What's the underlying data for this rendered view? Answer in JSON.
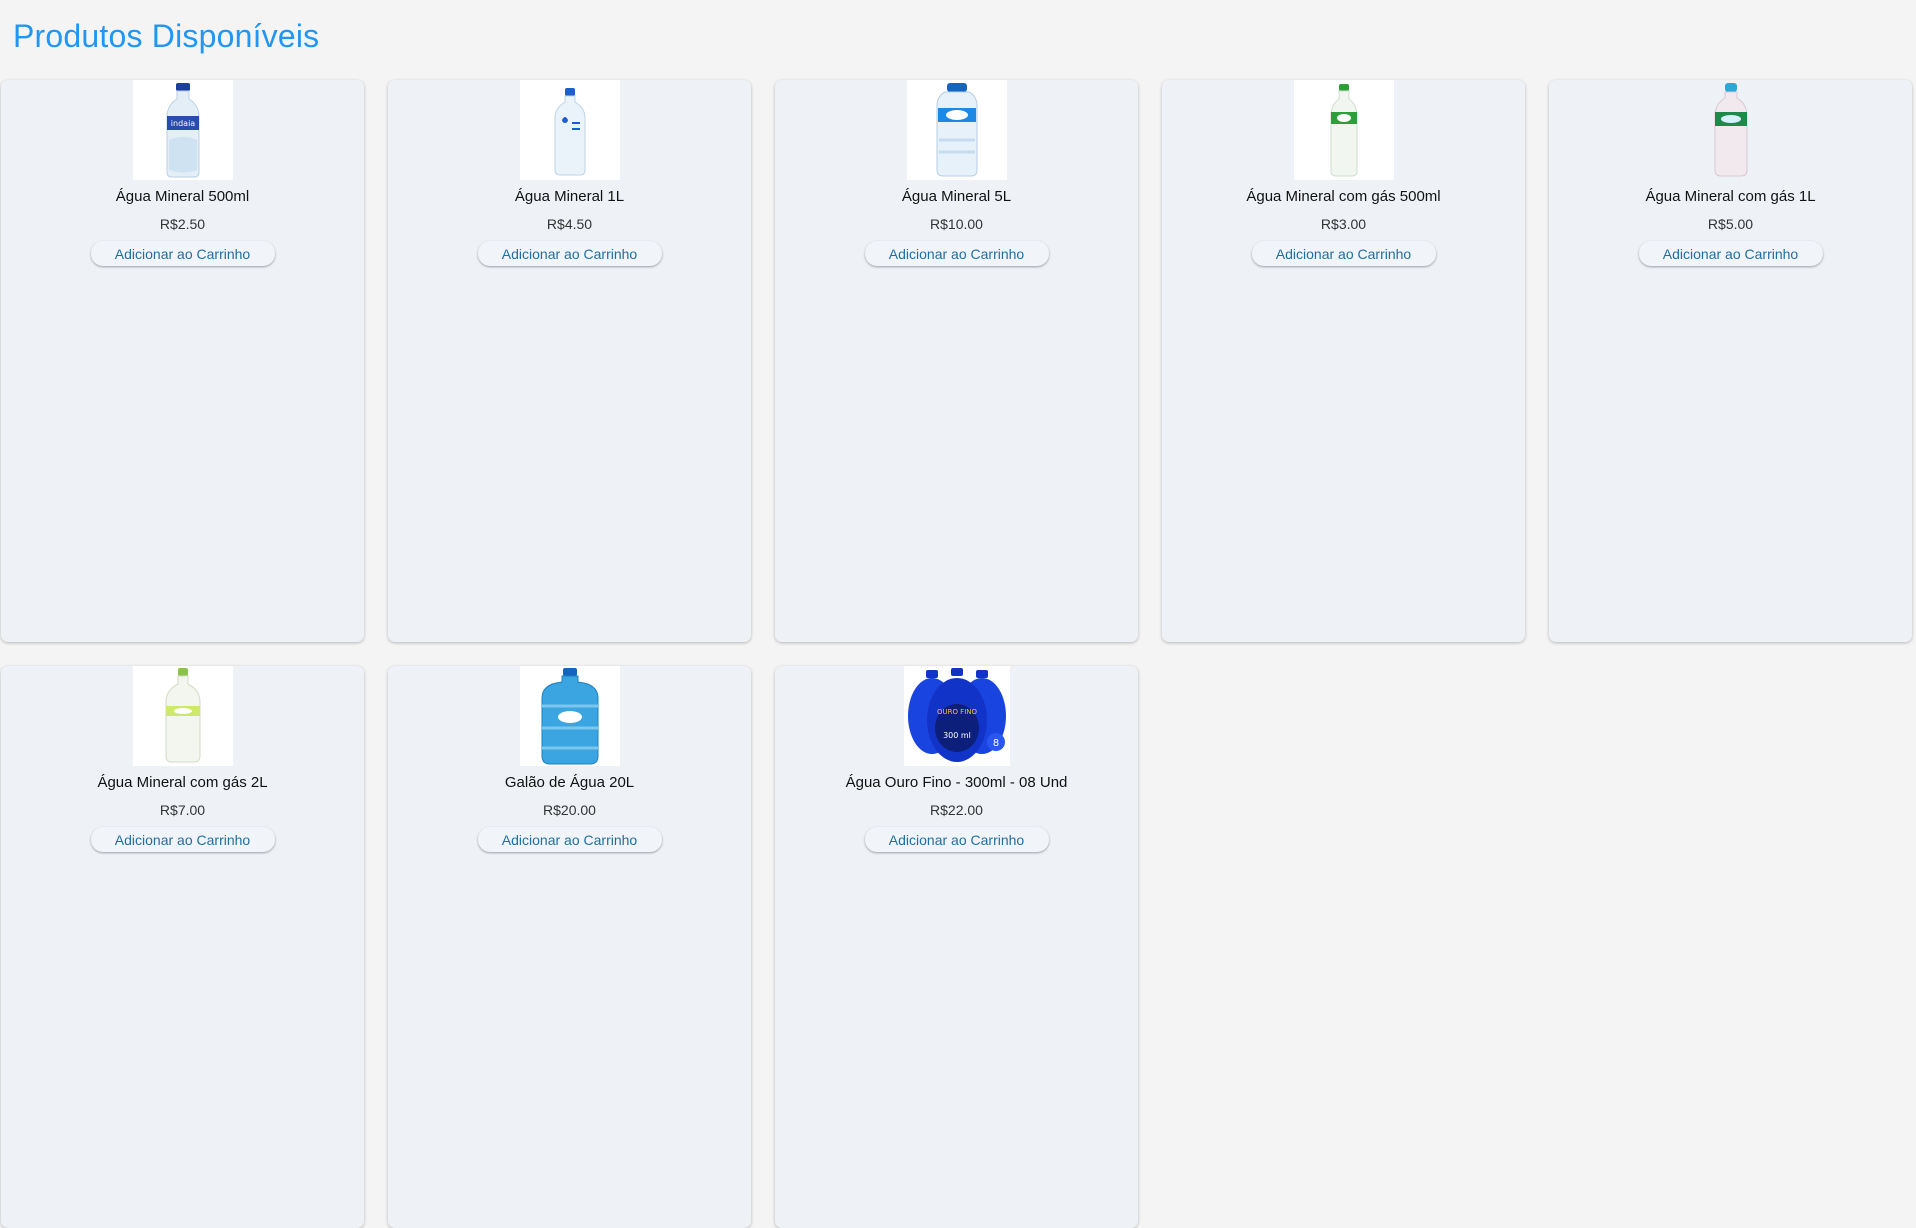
{
  "page": {
    "title": "Produtos Disponíveis"
  },
  "colors": {
    "title": "#2196f3",
    "card_bg": "#eef2f7",
    "button_text": "#1f6fa3"
  },
  "products": [
    {
      "name": "Água Mineral 500ml",
      "price": "R$2.50",
      "button": "Adicionar ao Carrinho",
      "image": "bottle-500ml-icon",
      "cap": "#1a3fa0",
      "label": "#2a4bb0"
    },
    {
      "name": "Água Mineral 1L",
      "price": "R$4.50",
      "button": "Adicionar ao Carrinho",
      "image": "bottle-1l-icon",
      "cap": "#1e5fd0",
      "label": "#d8ecf8"
    },
    {
      "name": "Água Mineral 5L",
      "price": "R$10.00",
      "button": "Adicionar ao Carrinho",
      "image": "bottle-5l-icon",
      "cap": "#1565c0",
      "label": "#1e88e5"
    },
    {
      "name": "Água Mineral com gás 500ml",
      "price": "R$3.00",
      "button": "Adicionar ao Carrinho",
      "image": "bottle-sparkling-500ml-icon",
      "cap": "#2e9e3a",
      "label": "#2e9e3a"
    },
    {
      "name": "Água Mineral com gás 1L",
      "price": "R$5.00",
      "button": "Adicionar ao Carrinho",
      "image": "bottle-sparkling-1l-icon",
      "cap": "#2aa7d6",
      "label": "#1d8a4a"
    },
    {
      "name": "Água Mineral com gás 2L",
      "price": "R$7.00",
      "button": "Adicionar ao Carrinho",
      "image": "bottle-sparkling-2l-icon",
      "cap": "#8bc34a",
      "label": "#cde86a"
    },
    {
      "name": "Galão de Água 20L",
      "price": "R$20.00",
      "button": "Adicionar ao Carrinho",
      "image": "water-jug-20l-icon",
      "cap": "#1565c0",
      "label": "#3aa5e0"
    },
    {
      "name": "Água Ouro Fino - 300ml - 08 Und",
      "price": "R$22.00",
      "button": "Adicionar ao Carrinho",
      "image": "ouro-fino-pack-icon",
      "cap": "#1233c8",
      "label": "#1a44e0"
    }
  ]
}
